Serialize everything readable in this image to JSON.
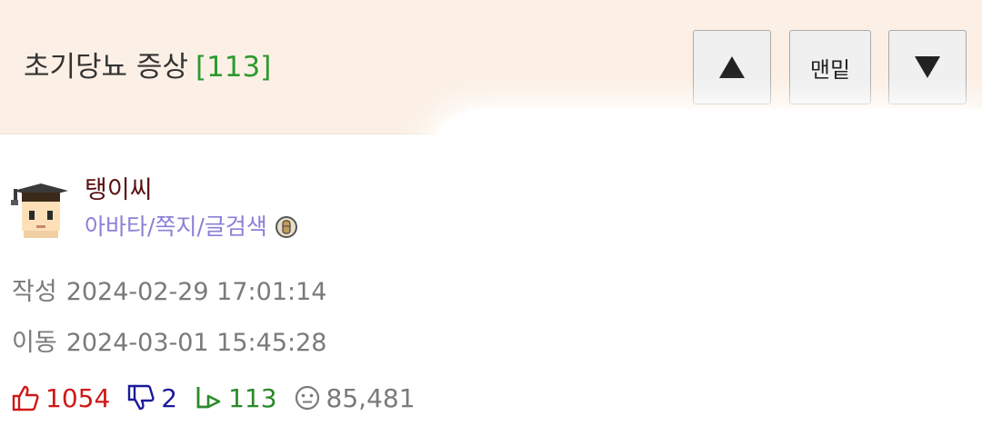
{
  "header": {
    "title": "초기당뇨 증상",
    "reply_count_label": "[113]",
    "btn_top_icon": "triangle-up-icon",
    "btn_bottom_label": "맨밑",
    "btn_down_icon": "triangle-down-icon"
  },
  "author": {
    "name": "탱이씨",
    "links": [
      "아바타",
      "쪽지",
      "글검색"
    ],
    "separator": "/",
    "badge_icon": "medal-icon",
    "avatar_icon": "graduate-pixel-avatar"
  },
  "meta": {
    "created_label": "작성",
    "created_at": "2024-02-29 17:01:14",
    "moved_label": "이동",
    "moved_at": "2024-03-01 15:45:28"
  },
  "stats": {
    "upvotes": "1054",
    "downvotes": "2",
    "replies": "113",
    "views": "85,481"
  },
  "colors": {
    "header_bg": "#fcf0e6",
    "reply_count": "#2e9a2e",
    "username": "#5a1010",
    "links": "#8a80d8",
    "upvote": "#d01818",
    "downvote": "#1a1a99",
    "reply": "#2a8a2a",
    "muted": "#7a7a7a"
  }
}
